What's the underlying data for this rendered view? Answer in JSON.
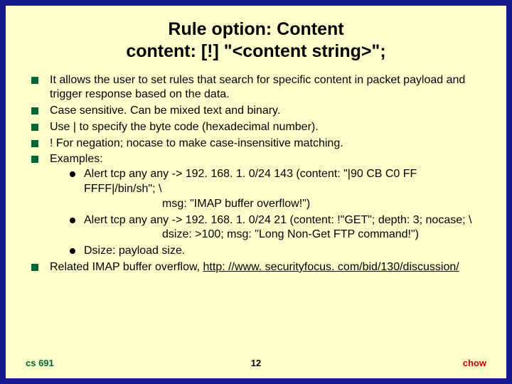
{
  "title1": "Rule option: Content",
  "title2": "content: [!] \"<content string>\";",
  "bullets": {
    "b0": "It allows the user to set rules that search for specific content in packet payload and trigger response based on the data.",
    "b1": "Case sensitive. Can be mixed text and binary.",
    "b2": "Use | to specify the byte code (hexadecimal number).",
    "b3": "! For negation; nocase to make case-insensitive matching.",
    "b4": "Examples:",
    "b5a": "Related IMAP buffer overflow, ",
    "b5link": "http: //www. securityfocus. com/bid/130/discussion/"
  },
  "ex": {
    "e0a": "Alert tcp any any -> 192. 168. 1. 0/24 143 (content: \"|90 CB C0 FF FFFF|/bin/sh\"; \\",
    "e0b": "msg: \"IMAP buffer overflow!\")",
    "e1a": "Alert tcp any any -> 192. 168. 1. 0/24 21 (content: !\"GET\"; depth: 3; nocase; \\",
    "e1b": "dsize: >100; msg: \"Long Non-Get FTP command!\")",
    "e2": "Dsize: payload size."
  },
  "footer": {
    "left": "cs 691",
    "center": "12",
    "right": "chow"
  }
}
